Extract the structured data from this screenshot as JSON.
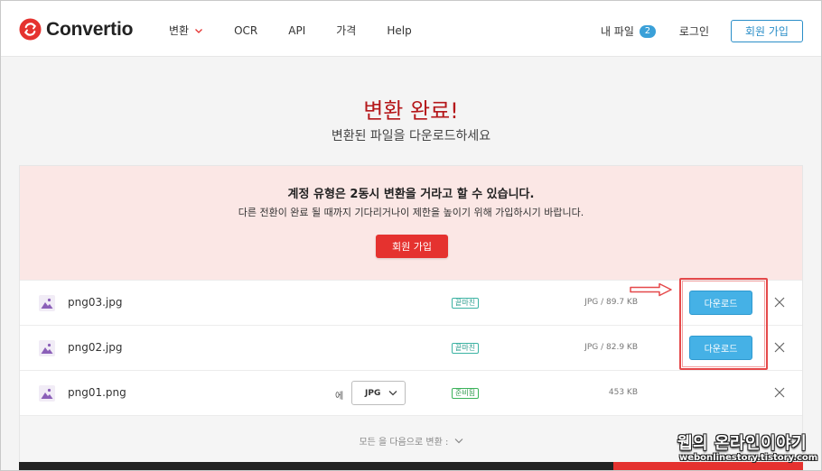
{
  "header": {
    "logo_text": "Convertio",
    "nav": [
      {
        "label": "변환",
        "has_dropdown": true
      },
      {
        "label": "OCR"
      },
      {
        "label": "API"
      },
      {
        "label": "가격"
      },
      {
        "label": "Help"
      }
    ],
    "my_files_label": "내 파일",
    "my_files_count": "2",
    "login_label": "로그인",
    "signup_label": "회원 가입"
  },
  "main": {
    "title": "변환 완료!",
    "subtitle": "변환된 파일을 다운로드하세요"
  },
  "notice": {
    "title": "계정 유형은 2동시 변환을 거라고 할 수 있습니다.",
    "text": "다른 전환이 완료 될 때까지 기다리거나이 제한을 높이기 위해 가입하시기 바랍니다.",
    "button_label": "회원 가입"
  },
  "files": [
    {
      "name": "png03.jpg",
      "status": "끝마친",
      "info": "JPG / 89.7 KB",
      "action": "다운로드"
    },
    {
      "name": "png02.jpg",
      "status": "끝마친",
      "info": "JPG / 82.9 KB",
      "action": "다운로드"
    },
    {
      "name": "png01.png",
      "status": "준비됨",
      "to_label": "에",
      "format": "JPG",
      "info": "453 KB"
    }
  ],
  "convert_all_label": "모든 을 다음으로 변환 :",
  "watermark": {
    "line1": "웹의 온라인이야기",
    "line2": "webonlinestory.tistory.com"
  },
  "colors": {
    "brand_red": "#e5322f",
    "title_red": "#b5171a",
    "download_blue": "#45b1e6",
    "notice_bg": "#fbe7e5"
  }
}
